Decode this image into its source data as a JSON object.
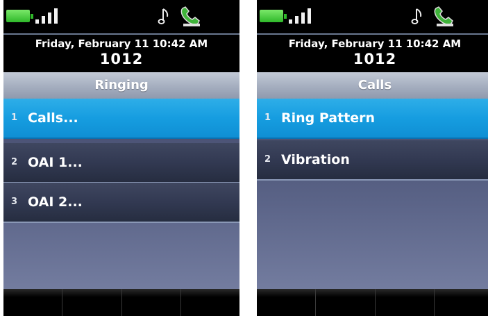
{
  "screens": [
    {
      "status": {
        "battery_icon": "battery-full-icon",
        "signal_icon": "signal-strength-icon",
        "ringer_icon": "music-note-icon",
        "line_icon": "handset-registered-icon"
      },
      "datetime": "Friday, February 11 10:42 AM",
      "extension": "1012",
      "title": "Ringing",
      "menu": [
        {
          "num": "1",
          "label": "Calls...",
          "selected": true
        },
        {
          "num": "2",
          "label": "OAI 1...",
          "selected": false
        },
        {
          "num": "3",
          "label": "OAI 2...",
          "selected": false
        }
      ],
      "softkeys": [
        "",
        "",
        "",
        ""
      ]
    },
    {
      "status": {
        "battery_icon": "battery-full-icon",
        "signal_icon": "signal-strength-icon",
        "ringer_icon": "music-note-icon",
        "line_icon": "handset-registered-icon"
      },
      "datetime": "Friday, February 11 10:42 AM",
      "extension": "1012",
      "title": "Calls",
      "menu": [
        {
          "num": "1",
          "label": "Ring Pattern",
          "selected": true
        },
        {
          "num": "2",
          "label": "Vibration",
          "selected": false
        }
      ],
      "softkeys": [
        "",
        "",
        "",
        ""
      ]
    }
  ],
  "colors": {
    "selected": "#169de0",
    "item": "#323952",
    "title_bar": "#a7b0c1",
    "battery": "#2fb82a",
    "handset": "#3fb33a"
  }
}
